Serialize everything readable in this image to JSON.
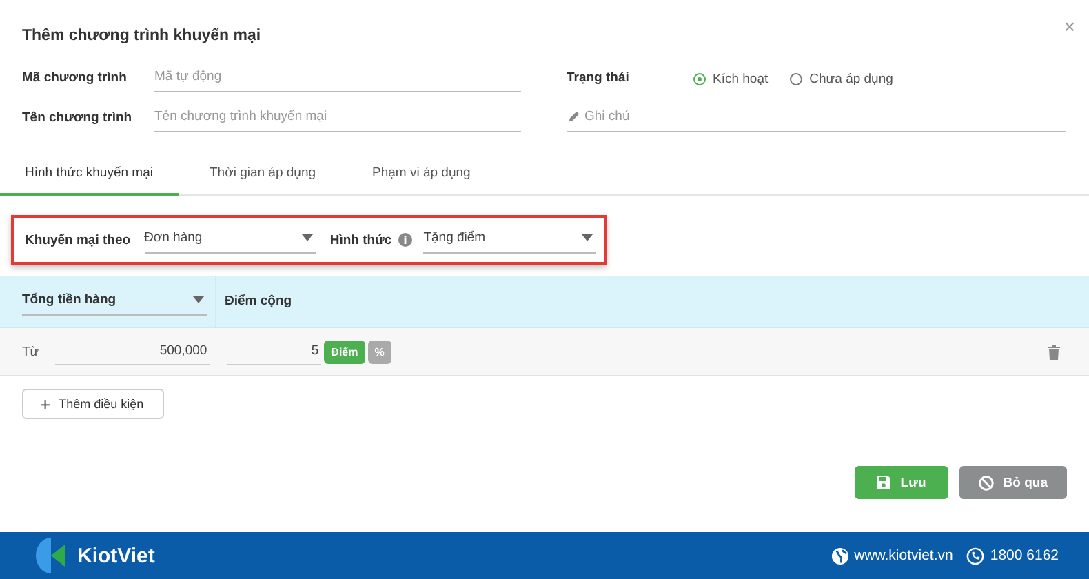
{
  "dialog": {
    "title": "Thêm chương trình khuyến mại",
    "close": "×"
  },
  "code_field": {
    "label": "Mã chương trình",
    "placeholder": "Mã tự động"
  },
  "name_field": {
    "label": "Tên chương trình",
    "placeholder": "Tên chương trình khuyến mại"
  },
  "status": {
    "label": "Trạng thái",
    "options": [
      {
        "label": "Kích hoạt",
        "selected": true
      },
      {
        "label": "Chưa áp dụng",
        "selected": false
      }
    ]
  },
  "note_field": {
    "placeholder": "Ghi chú"
  },
  "tabs": [
    {
      "label": "Hình thức khuyến mại",
      "selected": true
    },
    {
      "label": "Thời gian áp dụng",
      "selected": false
    },
    {
      "label": "Phạm vi áp dụng",
      "selected": false
    }
  ],
  "promo_settings": {
    "highlighted": true,
    "promo_by": {
      "label": "Khuyến mại theo",
      "value": "Đơn hàng"
    },
    "type": {
      "label": "Hình thức",
      "value": "Tặng điểm"
    }
  },
  "conditions": {
    "columns": [
      {
        "kind": "select",
        "value": "Tổng tiền hàng"
      },
      {
        "kind": "text",
        "label": "Điểm cộng"
      }
    ],
    "rows": [
      {
        "from_label": "Từ",
        "amount": "500,000",
        "points": "5",
        "units": [
          {
            "label": "Điểm",
            "selected": true
          },
          {
            "label": "%",
            "selected": false
          }
        ]
      }
    ]
  },
  "add_condition_button": {
    "icon": "+",
    "label": "Thêm điều kiện"
  },
  "buttons": [
    {
      "kind": "save",
      "label": "Lưu"
    },
    {
      "kind": "cancel",
      "label": "Bỏ qua"
    }
  ],
  "footer": {
    "brand": "KiotViet",
    "website": "www.kiotviet.vn",
    "phone": "1800 6162"
  }
}
